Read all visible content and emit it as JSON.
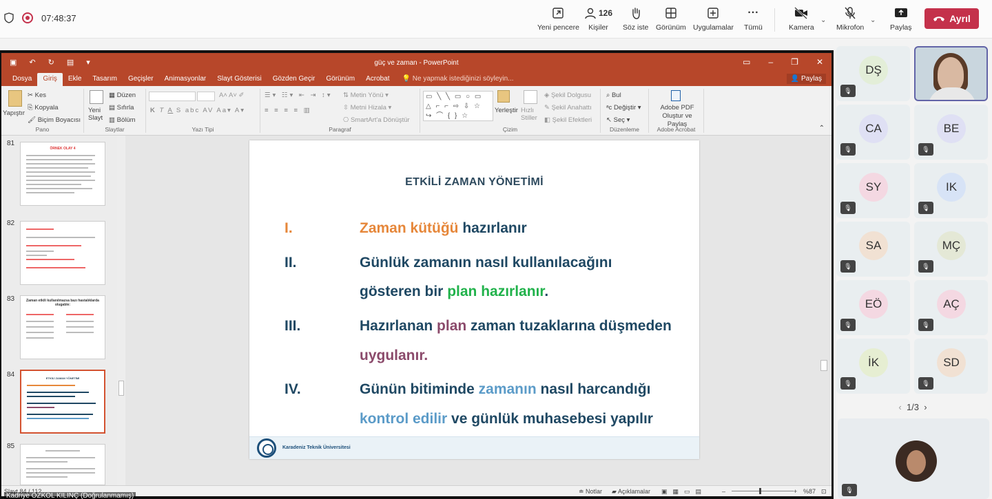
{
  "topbar": {
    "timer": "07:48:37",
    "buttons": [
      {
        "label": "Yeni pencere",
        "icon": "new-window-icon"
      },
      {
        "label": "Kişiler",
        "icon": "people-icon",
        "count": "126"
      },
      {
        "label": "Söz iste",
        "icon": "raise-hand-icon"
      },
      {
        "label": "Görünüm",
        "icon": "layout-icon"
      },
      {
        "label": "Uygulamalar",
        "icon": "apps-icon"
      },
      {
        "label": "Tümü",
        "icon": "more-icon"
      },
      {
        "label": "Kamera",
        "icon": "camera-off-icon"
      },
      {
        "label": "Mikrofon",
        "icon": "mic-off-icon"
      },
      {
        "label": "Paylaş",
        "icon": "share-icon"
      }
    ],
    "leave_label": "Ayrıl"
  },
  "ppt": {
    "doc_title": "güç ve zaman - PowerPoint",
    "menu": [
      "Dosya",
      "Giriş",
      "Ekle",
      "Tasarım",
      "Geçişler",
      "Animasyonlar",
      "Slayt Gösterisi",
      "Gözden Geçir",
      "Görünüm",
      "Acrobat"
    ],
    "tell_me": "Ne yapmak istediğinizi söyleyin...",
    "share": "Paylaş",
    "ribbon": {
      "paste": "Yapıştır",
      "cut": "Kes",
      "copy": "Kopyala",
      "format_painter": "Biçim Boyacısı",
      "clipboard": "Pano",
      "new_slide": "Yeni Slayt",
      "layout": "Düzen",
      "reset": "Sıfırla",
      "section": "Bölüm",
      "slides": "Slaytlar",
      "font": "Yazı Tipi",
      "text_direction": "Metin Yönü",
      "align_text": "Metni Hizala",
      "smartart": "SmartArt'a Dönüştür",
      "paragraph": "Paragraf",
      "arrange": "Yerleştir",
      "quick_styles": "Hızlı Stiller",
      "shape_fill": "Şekil Dolgusu",
      "shape_outline": "Şekil Anahattı",
      "shape_effects": "Şekil Efektleri",
      "drawing": "Çizim",
      "find": "Bul",
      "replace": "Değiştir",
      "select": "Seç",
      "editing": "Düzenleme",
      "adobe_pdf": "Adobe PDF Oluştur ve Paylaş",
      "adobe_acrobat": "Adobe Acrobat"
    },
    "thumbnails": [
      {
        "num": "81",
        "title": "ÖRNEK OLAY 4"
      },
      {
        "num": "82",
        "title": ""
      },
      {
        "num": "83",
        "title": "Zaman etkili kullanılmazsa bazı hastalıklarda olugable:"
      },
      {
        "num": "84",
        "title": "ETKİLİ ZAMAN YÖNETİMİ"
      },
      {
        "num": "85",
        "title": ""
      }
    ],
    "slide": {
      "title": "ETKİLİ ZAMAN YÖNETİMİ",
      "items": [
        {
          "num": "I.",
          "l1": [
            "Zaman kütüğü",
            " hazırlanır"
          ]
        },
        {
          "num": "II.",
          "l1": "Günlük zamanın nasıl kullanılacağını",
          "l2": [
            "gösteren bir ",
            "plan hazırlanır",
            "."
          ]
        },
        {
          "num": "III.",
          "l1": [
            "Hazırlanan ",
            "plan",
            " zaman tuzaklarına düşmeden"
          ],
          "l2": "uygulanır."
        },
        {
          "num": "IV.",
          "l1": [
            "Günün bitiminde ",
            "zamanın",
            " nasıl harcandığı"
          ],
          "l2": [
            "kontrol edilir",
            " ve günlük muhasebesi yapılır"
          ]
        }
      ],
      "footer": "Karadeniz Teknik Üniversitesi"
    },
    "status": {
      "slide_count": "Slayt 84 / 112",
      "notes": "Notlar",
      "comments": "Açıklamalar",
      "zoom": "%87"
    },
    "presenter": "Kadriye ÖZKOL KILINÇ (Doğrulanmamış)"
  },
  "participants": [
    {
      "initials": "DŞ",
      "color": "#eef3e8"
    },
    {
      "initials": "",
      "video": true
    },
    {
      "initials": "CA",
      "color": "#ece9f3"
    },
    {
      "initials": "BE",
      "color": "#ece9f3"
    },
    {
      "initials": "SY",
      "color": "#f6e3ea"
    },
    {
      "initials": "IK",
      "color": "#e3ebf6"
    },
    {
      "initials": "SA",
      "color": "#f3ebe3"
    },
    {
      "initials": "MÇ",
      "color": "#eef0e6"
    },
    {
      "initials": "EÖ",
      "color": "#f6e3ea"
    },
    {
      "initials": "AÇ",
      "color": "#f6e3ea"
    },
    {
      "initials": "İK",
      "color": "#eef3e0"
    },
    {
      "initials": "SD",
      "color": "#f3ebe3"
    }
  ],
  "pager": "1/3"
}
